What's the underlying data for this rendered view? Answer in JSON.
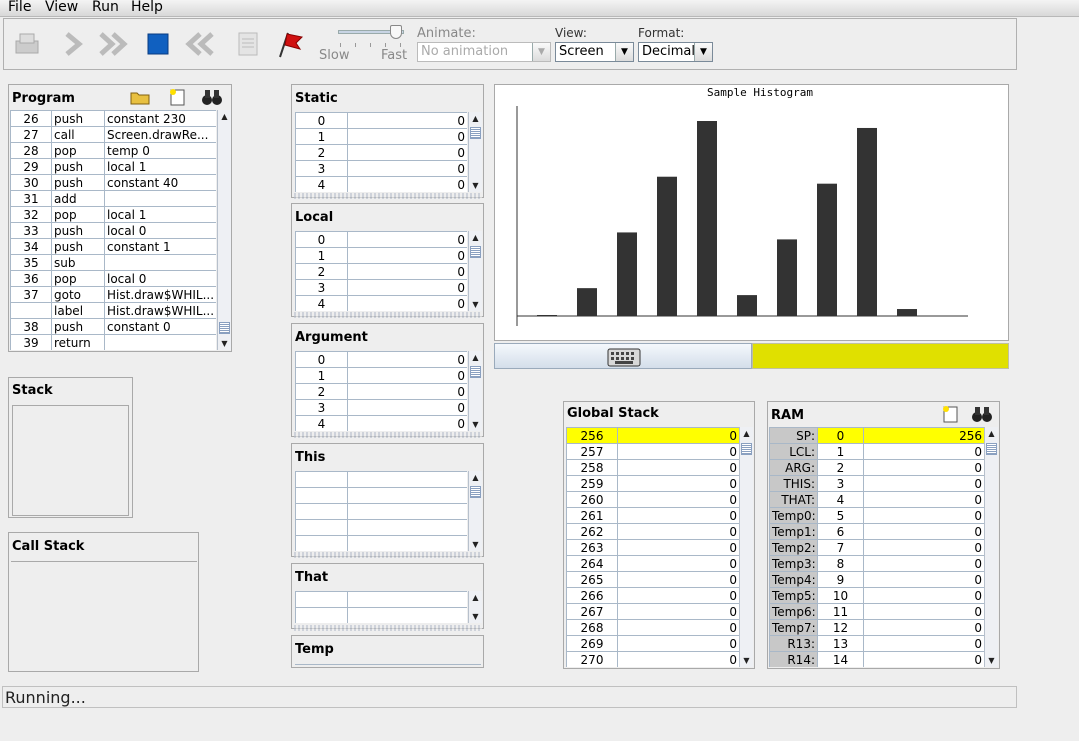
{
  "menu": [
    {
      "label": "File"
    },
    {
      "label": "View"
    },
    {
      "label": "Run"
    },
    {
      "label": "Help"
    }
  ],
  "toolbar": {
    "speed_slow": "Slow",
    "speed_fast": "Fast",
    "animate_label": "Animate:",
    "animate_value": "No animation",
    "view_label": "View:",
    "view_value": "Screen",
    "format_label": "Format:",
    "format_value": "Decimal"
  },
  "program": {
    "title": "Program",
    "rows": [
      {
        "n": "26",
        "op": "push",
        "arg": "constant 230"
      },
      {
        "n": "27",
        "op": "call",
        "arg": "Screen.drawRe..."
      },
      {
        "n": "28",
        "op": "pop",
        "arg": "temp 0"
      },
      {
        "n": "29",
        "op": "push",
        "arg": "local 1"
      },
      {
        "n": "30",
        "op": "push",
        "arg": "constant 40"
      },
      {
        "n": "31",
        "op": "add",
        "arg": ""
      },
      {
        "n": "32",
        "op": "pop",
        "arg": "local 1"
      },
      {
        "n": "33",
        "op": "push",
        "arg": "local 0"
      },
      {
        "n": "34",
        "op": "push",
        "arg": "constant 1"
      },
      {
        "n": "35",
        "op": "sub",
        "arg": ""
      },
      {
        "n": "36",
        "op": "pop",
        "arg": "local 0"
      },
      {
        "n": "37",
        "op": "goto",
        "arg": "Hist.draw$WHIL..."
      },
      {
        "n": "",
        "op": "label",
        "arg": "Hist.draw$WHIL..."
      },
      {
        "n": "38",
        "op": "push",
        "arg": "constant 0"
      },
      {
        "n": "39",
        "op": "return",
        "arg": ""
      }
    ]
  },
  "stack_title": "Stack",
  "callstack_title": "Call Stack",
  "segments": {
    "static": {
      "title": "Static",
      "rows": [
        [
          "0",
          "0"
        ],
        [
          "1",
          "0"
        ],
        [
          "2",
          "0"
        ],
        [
          "3",
          "0"
        ],
        [
          "4",
          "0"
        ]
      ]
    },
    "local": {
      "title": "Local",
      "rows": [
        [
          "0",
          "0"
        ],
        [
          "1",
          "0"
        ],
        [
          "2",
          "0"
        ],
        [
          "3",
          "0"
        ],
        [
          "4",
          "0"
        ]
      ]
    },
    "argument": {
      "title": "Argument",
      "rows": [
        [
          "0",
          "0"
        ],
        [
          "1",
          "0"
        ],
        [
          "2",
          "0"
        ],
        [
          "3",
          "0"
        ],
        [
          "4",
          "0"
        ]
      ]
    },
    "this": {
      "title": "This"
    },
    "that": {
      "title": "That"
    },
    "temp": {
      "title": "Temp"
    }
  },
  "screen": {
    "title": "Sample Histogram",
    "bars": [
      0,
      20,
      60,
      100,
      140,
      15,
      55,
      95,
      135,
      5
    ],
    "keyboard_color": "#e0e000"
  },
  "global_stack": {
    "title": "Global Stack",
    "rows": [
      [
        "256",
        "0"
      ],
      [
        "257",
        "0"
      ],
      [
        "258",
        "0"
      ],
      [
        "259",
        "0"
      ],
      [
        "260",
        "0"
      ],
      [
        "261",
        "0"
      ],
      [
        "262",
        "0"
      ],
      [
        "263",
        "0"
      ],
      [
        "264",
        "0"
      ],
      [
        "265",
        "0"
      ],
      [
        "266",
        "0"
      ],
      [
        "267",
        "0"
      ],
      [
        "268",
        "0"
      ],
      [
        "269",
        "0"
      ],
      [
        "270",
        "0"
      ]
    ]
  },
  "ram": {
    "title": "RAM",
    "rows": [
      [
        "SP:",
        "0",
        "256"
      ],
      [
        "LCL:",
        "1",
        "0"
      ],
      [
        "ARG:",
        "2",
        "0"
      ],
      [
        "THIS:",
        "3",
        "0"
      ],
      [
        "THAT:",
        "4",
        "0"
      ],
      [
        "Temp0:",
        "5",
        "0"
      ],
      [
        "Temp1:",
        "6",
        "0"
      ],
      [
        "Temp2:",
        "7",
        "0"
      ],
      [
        "Temp3:",
        "8",
        "0"
      ],
      [
        "Temp4:",
        "9",
        "0"
      ],
      [
        "Temp5:",
        "10",
        "0"
      ],
      [
        "Temp6:",
        "11",
        "0"
      ],
      [
        "Temp7:",
        "12",
        "0"
      ],
      [
        "R13:",
        "13",
        "0"
      ],
      [
        "R14:",
        "14",
        "0"
      ]
    ]
  },
  "status": "Running...",
  "colors": {
    "highlight": "#ffff00",
    "bar": "#333333"
  }
}
